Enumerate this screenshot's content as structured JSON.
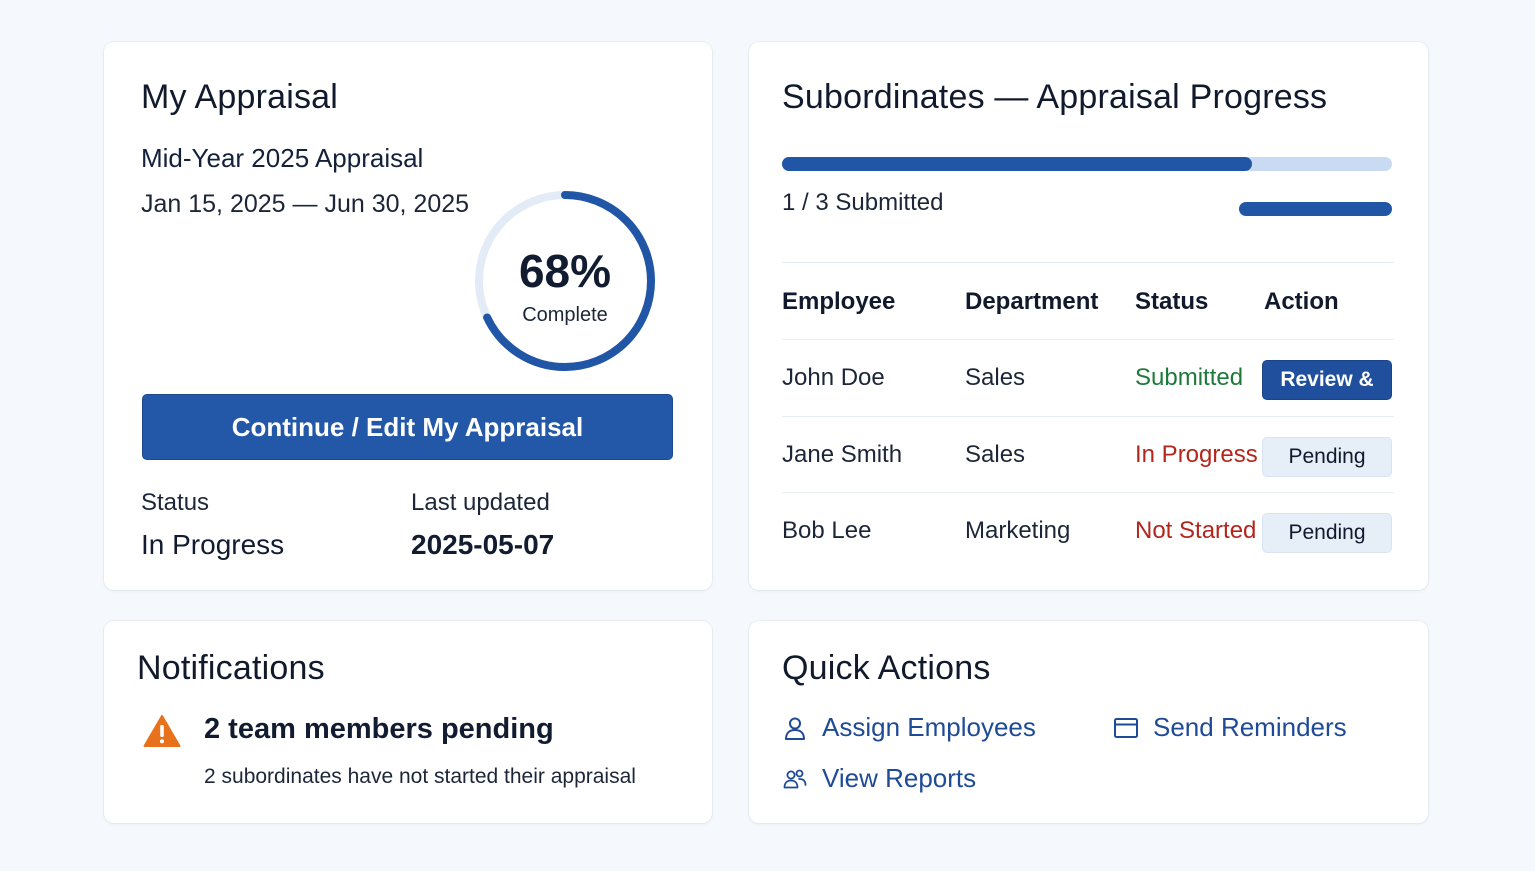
{
  "my_appraisal": {
    "title": "My Appraisal",
    "cycle_name": "Mid-Year 2025 Appraisal",
    "cycle_dates": "Jan 15, 2025 — Jun 30, 2025",
    "progress": {
      "value_label": "68%",
      "fraction": 0.68,
      "label": "Complete"
    },
    "continue_button": "Continue / Edit My Appraisal",
    "status_label": "Status",
    "status_value": "In Progress",
    "updated_label": "Last updated",
    "updated_value": "2025-05-07"
  },
  "subordinates": {
    "title": "Subordinates — Appraisal Progress",
    "progress_fraction": 0.77,
    "count_label": "1 / 3 Submitted",
    "columns": [
      "Employee",
      "Department",
      "Status",
      "Action"
    ],
    "rows": [
      {
        "employee": "John Doe",
        "department": "Sales",
        "status": "Submitted",
        "status_color": "#1e7a3a",
        "action": "Review &",
        "action_style": "primary"
      },
      {
        "employee": "Jane Smith",
        "department": "Sales",
        "status": "In Progress",
        "status_color": "#b3261e",
        "action": "Pending",
        "action_style": "muted"
      },
      {
        "employee": "Bob Lee",
        "department": "Marketing",
        "status": "Not Started",
        "status_color": "#b3261e",
        "action": "Pending",
        "action_style": "muted"
      }
    ]
  },
  "notifications": {
    "title": "Notifications",
    "items": [
      {
        "icon": "warning-icon",
        "headline": "2 team members pending",
        "detail": "2 subordinates have not started their appraisal"
      }
    ]
  },
  "quick_actions": {
    "title": "Quick Actions",
    "items": [
      {
        "icon": "user-icon",
        "label": "Assign Employees"
      },
      {
        "icon": "calendar-icon",
        "label": "Send Reminders"
      },
      {
        "icon": "team-icon",
        "label": "View Reports"
      }
    ]
  },
  "colors": {
    "accent": "#2358a8",
    "accent_light": "#c9dbf2",
    "success": "#1e7a3a",
    "danger": "#b3261e",
    "warning": "#e8711c",
    "link": "#1f4b96"
  }
}
